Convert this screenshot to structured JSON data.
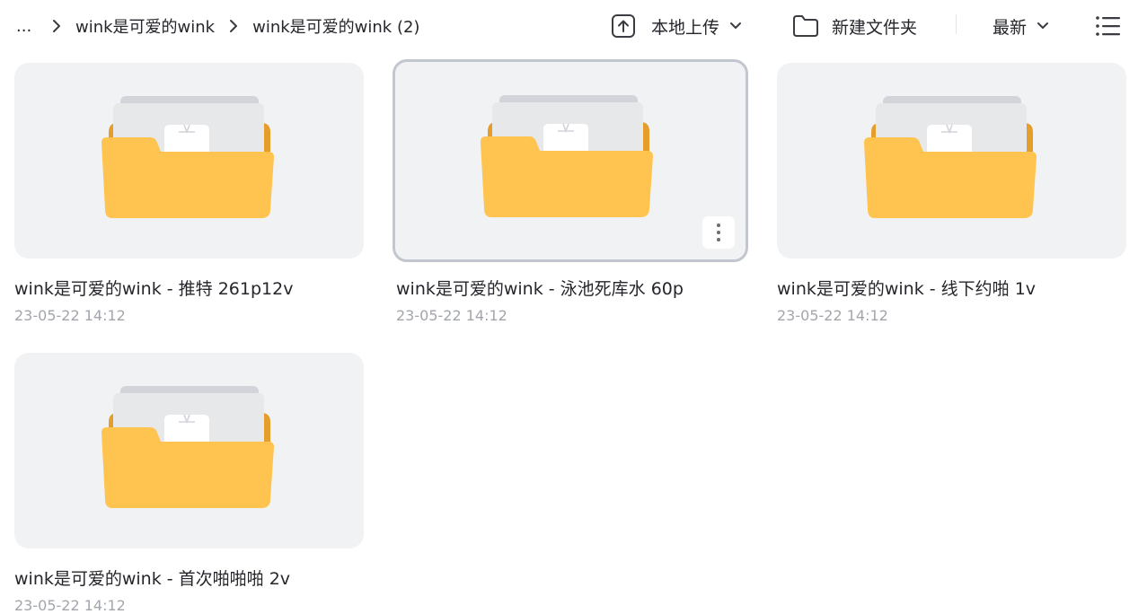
{
  "breadcrumb": {
    "ellipsis": "...",
    "items": [
      "wink是可爱的wink",
      "wink是可爱的wink (2)"
    ]
  },
  "toolbar": {
    "upload_label": "本地上传",
    "new_folder_label": "新建文件夹",
    "sort_label": "最新"
  },
  "icons": {
    "upload": "upload-icon",
    "folder": "folder-outline-icon",
    "chevron": "chevron-down-icon",
    "list_view": "list-view-icon",
    "more": "more-vertical-icon"
  },
  "colors": {
    "folder_front": "#ffc34f",
    "folder_back": "#e59e2c",
    "card_bg": "#f1f2f4",
    "selected_border": "#c2c6ce",
    "date_text": "#a2a5ab"
  },
  "items": [
    {
      "title": "wink是可爱的wink - 推特 261p12v",
      "date": "23-05-22 14:12"
    },
    {
      "title": "wink是可爱的wink - 泳池死库水 60p",
      "date": "23-05-22 14:12"
    },
    {
      "title": "wink是可爱的wink - 线下约啪 1v",
      "date": "23-05-22 14:12"
    },
    {
      "title": "wink是可爱的wink - 首次啪啪啪 2v",
      "date": "23-05-22 14:12"
    }
  ]
}
